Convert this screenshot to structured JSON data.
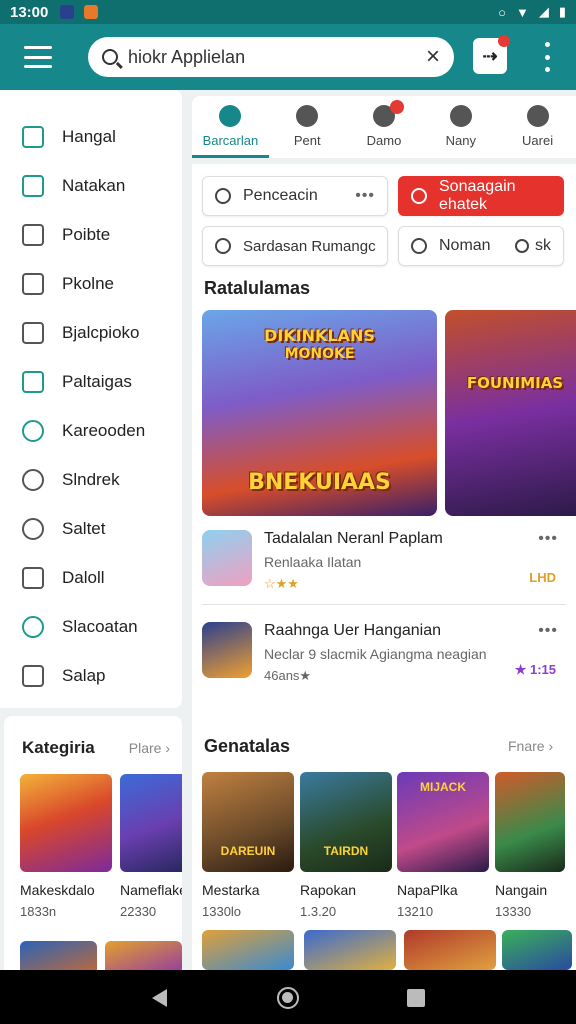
{
  "status": {
    "time": "13:00"
  },
  "search": {
    "query": "hiokr Applielan"
  },
  "sidebar": {
    "items": [
      {
        "label": "Hangal"
      },
      {
        "label": "Natakan"
      },
      {
        "label": "Poibte"
      },
      {
        "label": "Pkolne"
      },
      {
        "label": "Bjalcpioko"
      },
      {
        "label": "Paltaigas"
      },
      {
        "label": "Kareooden"
      },
      {
        "label": "Slndrek"
      },
      {
        "label": "Saltet"
      },
      {
        "label": "Daloll"
      },
      {
        "label": "Slacoatan"
      },
      {
        "label": "Salap"
      }
    ]
  },
  "categories": {
    "title": "Kategiria",
    "more": "Plare",
    "items": [
      {
        "name": "Makeskdalo",
        "sub": "1833n"
      },
      {
        "name": "Nameflake",
        "sub": "22330"
      }
    ]
  },
  "tabs": [
    {
      "label": "Barcarlan"
    },
    {
      "label": "Pent"
    },
    {
      "label": "Damo"
    },
    {
      "label": "Nany"
    },
    {
      "label": "Uarei"
    }
  ],
  "filters": {
    "search_chip": "Penceacin",
    "red_chip": "Sonaagain ehatek",
    "chip3": "Sardasan Rumangc",
    "chip4": "Noman",
    "chip5": "sk"
  },
  "featured": {
    "title": "Ratalulamas",
    "banners": [
      {
        "title_top": "DIKINKLANS",
        "title_mid": "MONOKE",
        "title_bottom": "BNEKUIAAS"
      },
      {
        "title_top": "FOUNIMIAS"
      }
    ]
  },
  "apps": [
    {
      "name": "Tadalalan Neranl Paplam",
      "sub": "Renlaaka Ilatan",
      "rating": "☆★★",
      "tag": "LHD"
    },
    {
      "name": "Raahnga Uer Hanganian",
      "sub": "Neclar 9 slacmik Agiangma neagian",
      "rating": "46ans★",
      "tag": "★ 1:15"
    }
  ],
  "popular": {
    "title": "Genatalas",
    "more": "Fnare",
    "items": [
      {
        "name": "Mestarka",
        "sub": "1330lo",
        "banner": "DAREUIN"
      },
      {
        "name": "Rapokan",
        "sub": "1.3.20",
        "banner": "TAIRDN"
      },
      {
        "name": "NapaPlka",
        "sub": "13210",
        "banner": "MIJACK"
      },
      {
        "name": "Nangain",
        "sub": "13330"
      }
    ]
  },
  "colors": {
    "primary": "#16878a",
    "accent_red": "#e5322c",
    "statusbar": "#0f6f6f"
  }
}
